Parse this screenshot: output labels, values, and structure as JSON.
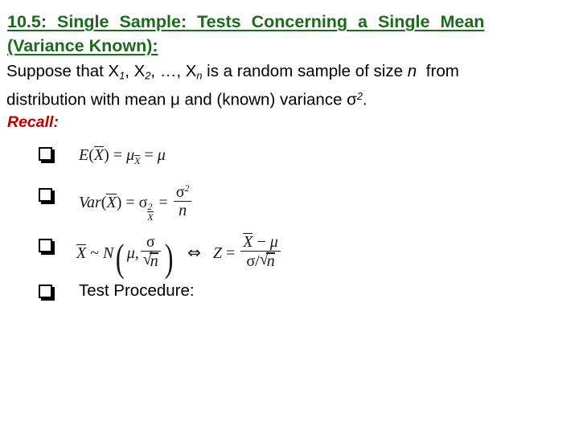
{
  "slide": {
    "background_color": "#ffffff",
    "title": {
      "color": "#1a6b1a",
      "line1": "10.5:  Single  Sample:  Tests  Concerning  a  Single  Mean",
      "line2": "(Variance Known):"
    },
    "intro": {
      "color": "#000000",
      "line1_part1": "Suppose that X",
      "line1_sub1": "1",
      "line1_part2": ", X",
      "line1_sub2": "2",
      "line1_part3": ", …, X",
      "line1_sub3": "n",
      "line1_part4": " is a random sample of size ",
      "line1_italic_n": "n",
      "line1_part5": " from",
      "line2_part1": "distribution with mean ",
      "line2_mu": "μ",
      "line2_part2": " and (known) variance ",
      "line2_sigma": "σ",
      "line2_sup": "2",
      "line2_part3": "."
    },
    "recall": {
      "label": "Recall:",
      "color": "#c00000"
    },
    "bullets": [
      {
        "marker": "hollow-square-shadow",
        "kind": "formula",
        "formula_text": "E(X̄) = μ_X̄ = μ",
        "parts": {
          "E": "E",
          "open": "(",
          "Xbar": "X",
          "close": ")",
          "eq1": "=",
          "mu": "μ",
          "mu_sub": "X",
          "eq2": "=",
          "mu2": "μ"
        }
      },
      {
        "marker": "hollow-square-shadow",
        "kind": "formula",
        "formula_text": "Var(X̄) = σ²_X̄ = σ² / n",
        "parts": {
          "Var": "Var",
          "open": "(",
          "Xbar": "X",
          "close": ")",
          "eq1": "=",
          "sigma": "σ",
          "sigma_sup": "2",
          "sigma_sub": "X",
          "eq2": "=",
          "num_sigma": "σ",
          "num_sup": "2",
          "den_n": "n"
        }
      },
      {
        "marker": "hollow-square-shadow",
        "kind": "formula",
        "formula_text": "X̄ ~ N(μ, σ/√n)  ⇔  Z = (X̄ − μ)/(σ/√n)",
        "parts": {
          "Xbar": "X",
          "tilde": "~",
          "N": "N",
          "paren_open": "(",
          "mu": "μ",
          "comma": ",",
          "sigma": "σ",
          "sqrt_n": "n",
          "paren_close": ")",
          "iff": "⇔",
          "Z": "Z",
          "eq": "=",
          "num_Xbar": "X",
          "minus": "−",
          "num_mu": "μ",
          "den_sigma": "σ",
          "den_slash": "/",
          "den_sqrt_n": "n"
        }
      },
      {
        "marker": "hollow-square-shadow",
        "kind": "text",
        "label": "Test Procedure:"
      }
    ]
  }
}
